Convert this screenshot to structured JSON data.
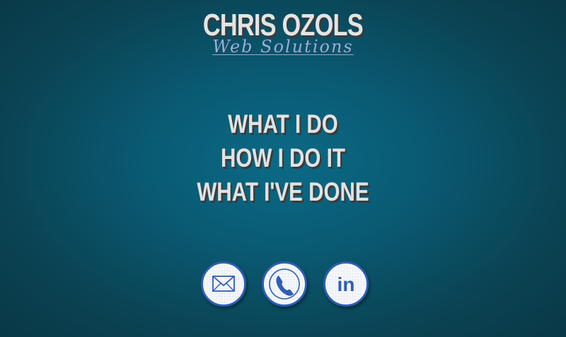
{
  "brand": {
    "name": "CHRIS OZOLS",
    "tagline": "Web Solutions"
  },
  "nav": {
    "items": [
      {
        "label": "WHAT I DO"
      },
      {
        "label": "HOW I DO IT"
      },
      {
        "label": "WHAT I'VE DONE"
      }
    ]
  },
  "social": {
    "items": [
      {
        "icon": "envelope-icon"
      },
      {
        "icon": "phone-icon"
      },
      {
        "icon": "linkedin-icon",
        "label": "in"
      }
    ],
    "accent_color": "#2d5fb5"
  },
  "colors": {
    "background": "#0a5a73",
    "heading_text": "#e2e2e2",
    "tagline_text": "#8fb4d9"
  }
}
